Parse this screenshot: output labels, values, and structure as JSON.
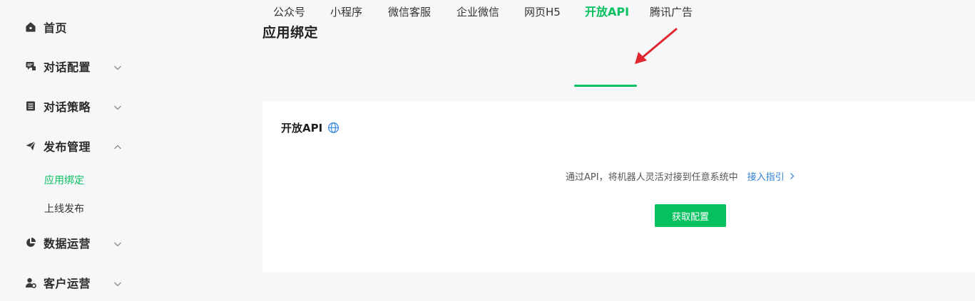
{
  "sidebar": {
    "items": [
      {
        "label": "首页",
        "icon": "home-icon"
      },
      {
        "label": "对话配置",
        "icon": "chat-config-icon",
        "expanded": false
      },
      {
        "label": "对话策略",
        "icon": "strategy-list-icon",
        "expanded": false
      },
      {
        "label": "发布管理",
        "icon": "send-icon",
        "expanded": true,
        "children": [
          {
            "label": "应用绑定",
            "active": true
          },
          {
            "label": "上线发布",
            "active": false
          }
        ]
      },
      {
        "label": "数据运营",
        "icon": "pie-chart-icon",
        "expanded": false
      },
      {
        "label": "客户运营",
        "icon": "user-settings-icon",
        "expanded": false
      }
    ]
  },
  "page": {
    "title": "应用绑定"
  },
  "tabs": [
    {
      "label": "公众号"
    },
    {
      "label": "小程序"
    },
    {
      "label": "微信客服"
    },
    {
      "label": "企业微信"
    },
    {
      "label": "网页H5"
    },
    {
      "label": "开放API",
      "active": true
    },
    {
      "label": "腾讯广告"
    }
  ],
  "card": {
    "title": "开放API",
    "description": "通过API，将机器人灵活对接到任意系统中",
    "guide_link": "接入指引",
    "button_label": "获取配置"
  },
  "colors": {
    "accent": "#07c160",
    "link": "#2f7fd6",
    "annotation_arrow": "#e0262f"
  }
}
